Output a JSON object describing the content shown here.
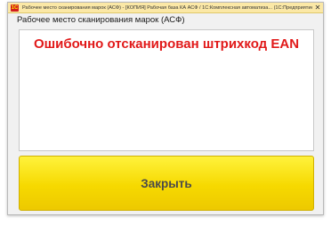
{
  "window": {
    "title": "Рабочее место сканирования марок (АСФ) - [КОПИЯ] Рабочая база КА АСФ / 1С:Комплексная автоматиза... (1С:Предприятие)",
    "app_icon": "1С",
    "close_glyph": "✕"
  },
  "form": {
    "header": "Рабочее место сканирования марок (АСФ)",
    "error_message": "Ошибочно отсканирован штрихкод EAN",
    "close_button_label": "Закрыть"
  },
  "colors": {
    "title_bar": "#fbe8a6",
    "error_text": "#e11919",
    "button_yellow": "#f6d900"
  }
}
